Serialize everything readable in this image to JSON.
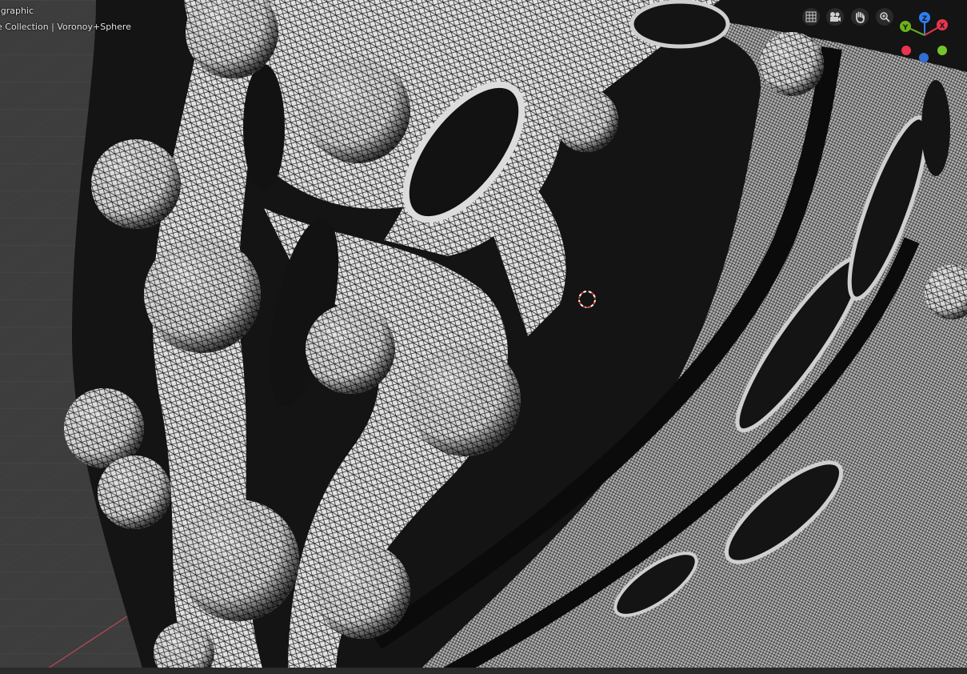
{
  "viewport": {
    "view_mode": "Orthographic",
    "view_mode_visible": "ographic",
    "collection_line": "e Collection | Voronoy+Sphere"
  },
  "navigation": {
    "icons": [
      "grid-toggle-icon",
      "camera-icon",
      "pan-hand-icon",
      "zoom-icon"
    ]
  },
  "gizmo": {
    "axes": [
      {
        "label": "Z",
        "color": "#2f7ff7"
      },
      {
        "label": "Y",
        "color": "#6bb31a"
      },
      {
        "label": "X",
        "color": "#e8344c"
      }
    ]
  },
  "colors": {
    "background": "#3d3d3d",
    "grid": "#474747",
    "x_axis": "#a5424a",
    "y_axis": "#7a9b2d",
    "mesh_face": "#d8d8d8",
    "wire": "#111111"
  }
}
